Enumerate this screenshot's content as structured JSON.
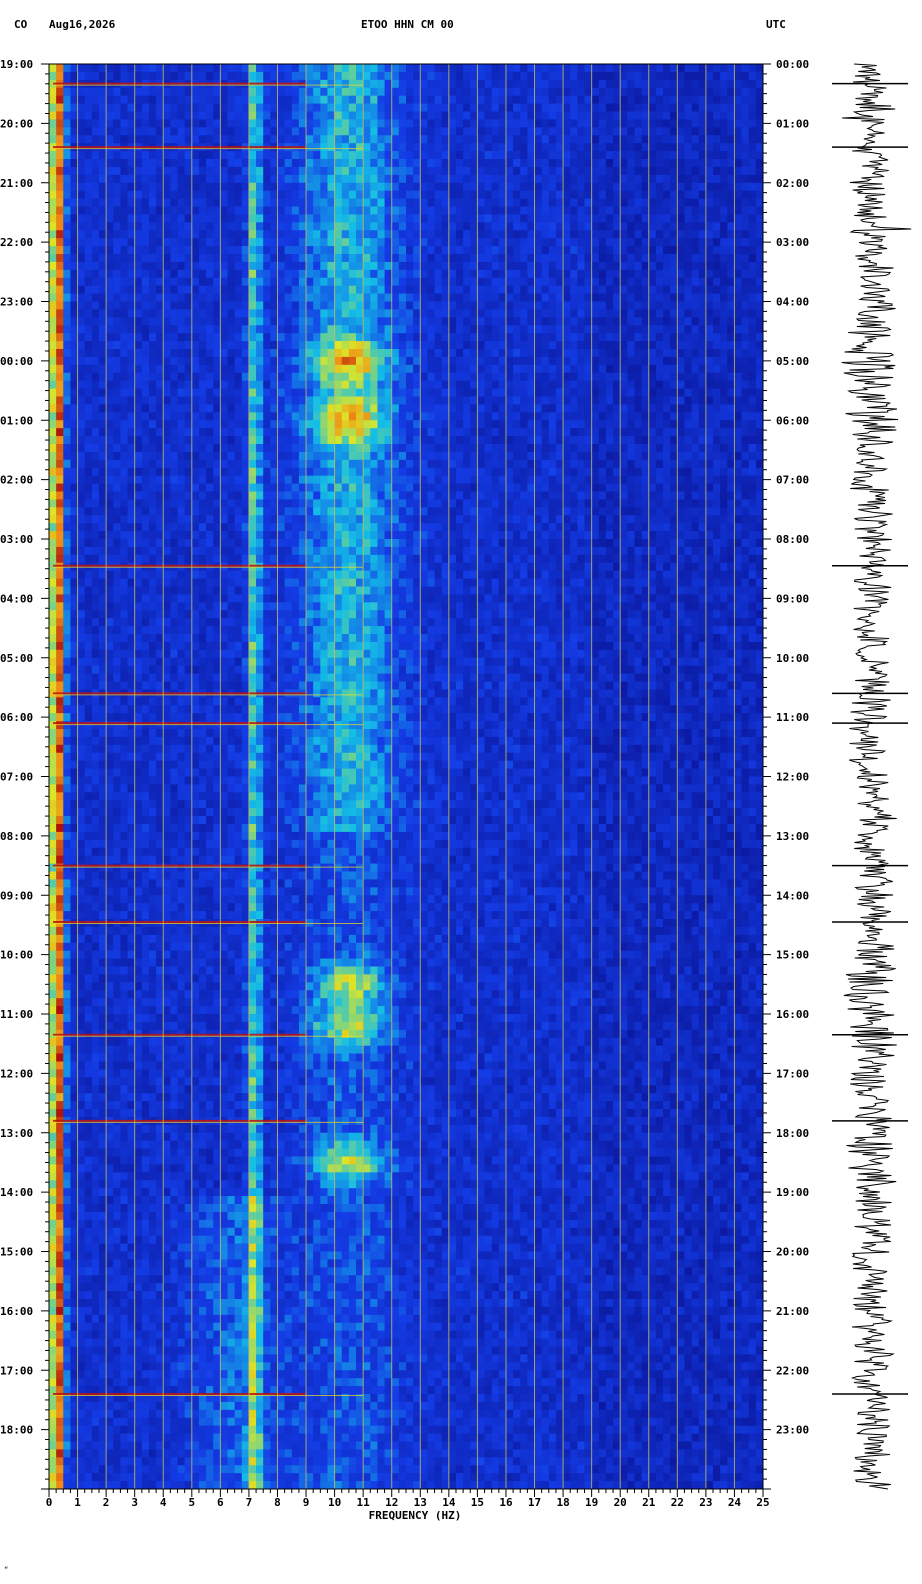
{
  "header": {
    "network": "CO",
    "date": "Aug16,2026",
    "station": "ETOO HHN CM 00",
    "tz": "UTC"
  },
  "footer": {
    "mark": "“"
  },
  "colors": {
    "background_low": "#0a1fb8",
    "mid": "#17c5e0",
    "high": "#f0e020",
    "peak": "#c01010",
    "grid": "#c8c060",
    "trace": "#000000"
  },
  "chart_data": {
    "type": "heatmap",
    "title": "ETOO HHN CM 00",
    "xlabel": "FREQUENCY (HZ)",
    "xlim": [
      0,
      25
    ],
    "x_ticks": [
      "0",
      "1",
      "2",
      "3",
      "4",
      "5",
      "6",
      "7",
      "8",
      "9",
      "10",
      "11",
      "12",
      "13",
      "14",
      "15",
      "16",
      "17",
      "18",
      "19",
      "20",
      "21",
      "22",
      "23",
      "24",
      "25"
    ],
    "grid": true,
    "y_left_ticks": [
      "19:00",
      "20:00",
      "21:00",
      "22:00",
      "23:00",
      "00:00",
      "01:00",
      "02:00",
      "03:00",
      "04:00",
      "05:00",
      "06:00",
      "07:00",
      "08:00",
      "09:00",
      "10:00",
      "11:00",
      "12:00",
      "13:00",
      "14:00",
      "15:00",
      "16:00",
      "17:00",
      "18:00"
    ],
    "y_right_ticks": [
      "00:00",
      "01:00",
      "02:00",
      "03:00",
      "04:00",
      "05:00",
      "06:00",
      "07:00",
      "08:00",
      "09:00",
      "10:00",
      "11:00",
      "12:00",
      "13:00",
      "14:00",
      "15:00",
      "16:00",
      "17:00",
      "18:00",
      "19:00",
      "20:00",
      "21:00",
      "22:00",
      "23:00"
    ],
    "y_hours": 24,
    "features": {
      "low_freq_band_hz": 0.3,
      "microseism_band_hz": 7.2,
      "cultural_band_hz": [
        9,
        12
      ],
      "high_energy_hours": [
        5.0,
        6.0,
        15.5,
        16.2,
        18.5
      ],
      "event_lines_hours": [
        0.33,
        1.4,
        8.45,
        10.6,
        11.1,
        13.5,
        14.45,
        16.35,
        17.8,
        22.4
      ]
    }
  }
}
